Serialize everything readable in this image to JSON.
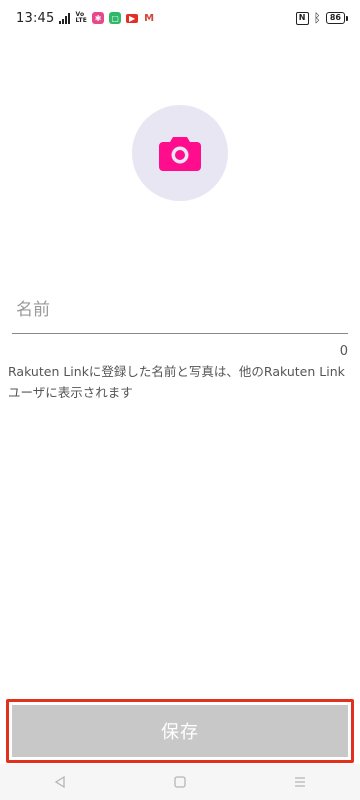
{
  "status_bar": {
    "time": "13:45",
    "volte_top": "Vo",
    "volte_bottom": "LTE",
    "battery": "86"
  },
  "profile": {
    "avatar_icon": "camera-icon",
    "accent_color": "#ff0d8c",
    "avatar_bg": "#e8e6f3"
  },
  "name_field": {
    "placeholder": "名前",
    "value": "",
    "counter": "0"
  },
  "helper_text": "Rakuten Linkに登録した名前と写真は、他のRakuten Linkユーザに表示されます",
  "save_button": {
    "label": "保存",
    "disabled_color": "#c8c8c8",
    "highlight_color": "#e0301e"
  },
  "nav_bar": {
    "back_icon": "back-triangle-icon",
    "home_icon": "home-square-icon",
    "menu_icon": "menu-lines-icon"
  }
}
